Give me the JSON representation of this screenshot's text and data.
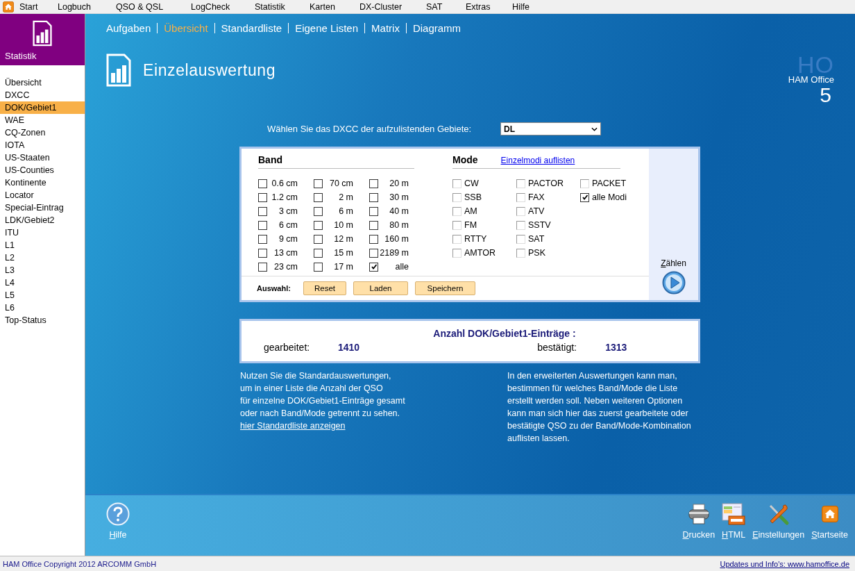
{
  "menu_bar": {
    "items": [
      "Start",
      "Logbuch",
      "QSO & QSL",
      "LogCheck",
      "Statistik",
      "Karten",
      "DX-Cluster",
      "SAT",
      "Extras",
      "Hilfe"
    ]
  },
  "sidebar": {
    "title": "Statistik",
    "items": [
      {
        "label": "Übersicht",
        "selected": false
      },
      {
        "label": "DXCC",
        "selected": false
      },
      {
        "label": "DOK/Gebiet1",
        "selected": true
      },
      {
        "label": "WAE",
        "selected": false
      },
      {
        "label": "CQ-Zonen",
        "selected": false
      },
      {
        "label": "IOTA",
        "selected": false
      },
      {
        "label": "US-Staaten",
        "selected": false
      },
      {
        "label": "US-Counties",
        "selected": false
      },
      {
        "label": "Kontinente",
        "selected": false
      },
      {
        "label": "Locator",
        "selected": false
      },
      {
        "label": "Special-Eintrag",
        "selected": false
      },
      {
        "label": "LDK/Gebiet2",
        "selected": false
      },
      {
        "label": "ITU",
        "selected": false
      },
      {
        "label": "L1",
        "selected": false
      },
      {
        "label": "L2",
        "selected": false
      },
      {
        "label": "L3",
        "selected": false
      },
      {
        "label": "L4",
        "selected": false
      },
      {
        "label": "L5",
        "selected": false
      },
      {
        "label": "L6",
        "selected": false
      },
      {
        "label": "Top-Status",
        "selected": false
      }
    ]
  },
  "nav": [
    {
      "label": "Aufgaben",
      "selected": false
    },
    {
      "label": "Übersicht",
      "selected": true
    },
    {
      "label": "Standardliste",
      "selected": false
    },
    {
      "label": "Eigene Listen",
      "selected": false
    },
    {
      "label": "Matrix",
      "selected": false
    },
    {
      "label": "Diagramm",
      "selected": false
    }
  ],
  "header": {
    "title": "Einzelauswertung"
  },
  "logo": {
    "watermark": "HO",
    "name": "HAM Office",
    "version": "5"
  },
  "dxcc": {
    "label": "Wählen Sie das DXCC der aufzulistenden Gebiete:",
    "value": "DL"
  },
  "band": {
    "heading": "Band",
    "columns": [
      [
        {
          "label": "0.6 cm",
          "checked": false
        },
        {
          "label": "1.2 cm",
          "checked": false
        },
        {
          "label": "3 cm",
          "checked": false
        },
        {
          "label": "6 cm",
          "checked": false
        },
        {
          "label": "9 cm",
          "checked": false
        },
        {
          "label": "13 cm",
          "checked": false
        },
        {
          "label": "23 cm",
          "checked": false
        }
      ],
      [
        {
          "label": "70 cm",
          "checked": false
        },
        {
          "label": "2 m",
          "checked": false
        },
        {
          "label": "6 m",
          "checked": false
        },
        {
          "label": "10 m",
          "checked": false
        },
        {
          "label": "12 m",
          "checked": false
        },
        {
          "label": "15 m",
          "checked": false
        },
        {
          "label": "17 m",
          "checked": false
        }
      ],
      [
        {
          "label": "20 m",
          "checked": false
        },
        {
          "label": "30 m",
          "checked": false
        },
        {
          "label": "40 m",
          "checked": false
        },
        {
          "label": "80 m",
          "checked": false
        },
        {
          "label": "160 m",
          "checked": false
        },
        {
          "label": "2189 m",
          "checked": false
        },
        {
          "label": "alle",
          "checked": true
        }
      ]
    ]
  },
  "mode": {
    "heading": "Mode",
    "link": "Einzelmodi auflisten",
    "columns": [
      [
        {
          "label": "CW",
          "checked": false,
          "disabled": true
        },
        {
          "label": "SSB",
          "checked": false,
          "disabled": true
        },
        {
          "label": "AM",
          "checked": false,
          "disabled": true
        },
        {
          "label": "FM",
          "checked": false,
          "disabled": true
        },
        {
          "label": "RTTY",
          "checked": false,
          "disabled": true
        },
        {
          "label": "AMTOR",
          "checked": false,
          "disabled": true
        }
      ],
      [
        {
          "label": "PACTOR",
          "checked": false,
          "disabled": true
        },
        {
          "label": "FAX",
          "checked": false,
          "disabled": true
        },
        {
          "label": "ATV",
          "checked": false,
          "disabled": true
        },
        {
          "label": "SSTV",
          "checked": false,
          "disabled": true
        },
        {
          "label": "SAT",
          "checked": false,
          "disabled": true
        },
        {
          "label": "PSK",
          "checked": false,
          "disabled": true
        }
      ],
      [
        {
          "label": "PACKET",
          "checked": false,
          "disabled": true
        },
        {
          "label": "alle Modi",
          "checked": true,
          "disabled": false
        }
      ]
    ]
  },
  "selection": {
    "label": "Auswahl:",
    "buttons": [
      "Reset",
      "Laden",
      "Speichern"
    ]
  },
  "count_button": {
    "label": "Zählen"
  },
  "result": {
    "title": "Anzahl DOK/Gebiet1-Einträge :",
    "worked_label": "gearbeitet:",
    "worked": "1410",
    "confirmed_label": "bestätigt:",
    "confirmed": "1313"
  },
  "info_left": {
    "lines": [
      "Nutzen Sie die Standardauswertungen,",
      "um in einer Liste die Anzahl der QSO",
      "für einzelne DOK/Gebiet1-Einträge gesamt",
      "oder nach Band/Mode getrennt zu sehen."
    ],
    "link": "hier Standardliste anzeigen"
  },
  "info_right": {
    "lines": [
      "In den erweiterten Auswertungen kann man,",
      "bestimmen für welches Band/Mode die Liste",
      "erstellt werden soll. Neben weiteren Optionen",
      "kann man sich hier das zuerst gearbeitete oder",
      "bestätigte QSO zu der Band/Mode-Kombination",
      "auflisten lassen."
    ]
  },
  "footer": {
    "left": [
      {
        "kind": "help",
        "label": "Hilfe"
      }
    ],
    "right": [
      {
        "kind": "print",
        "label": "Drucken"
      },
      {
        "kind": "html",
        "label": "HTML"
      },
      {
        "kind": "settings",
        "label": "Einstellungen"
      },
      {
        "kind": "home",
        "label": "Startseite"
      }
    ]
  },
  "status_bar": {
    "left": "HAM Office Copyright 2012 ARCOMM GmbH",
    "right": "Updates und Info's: www.hamoffice.de"
  }
}
